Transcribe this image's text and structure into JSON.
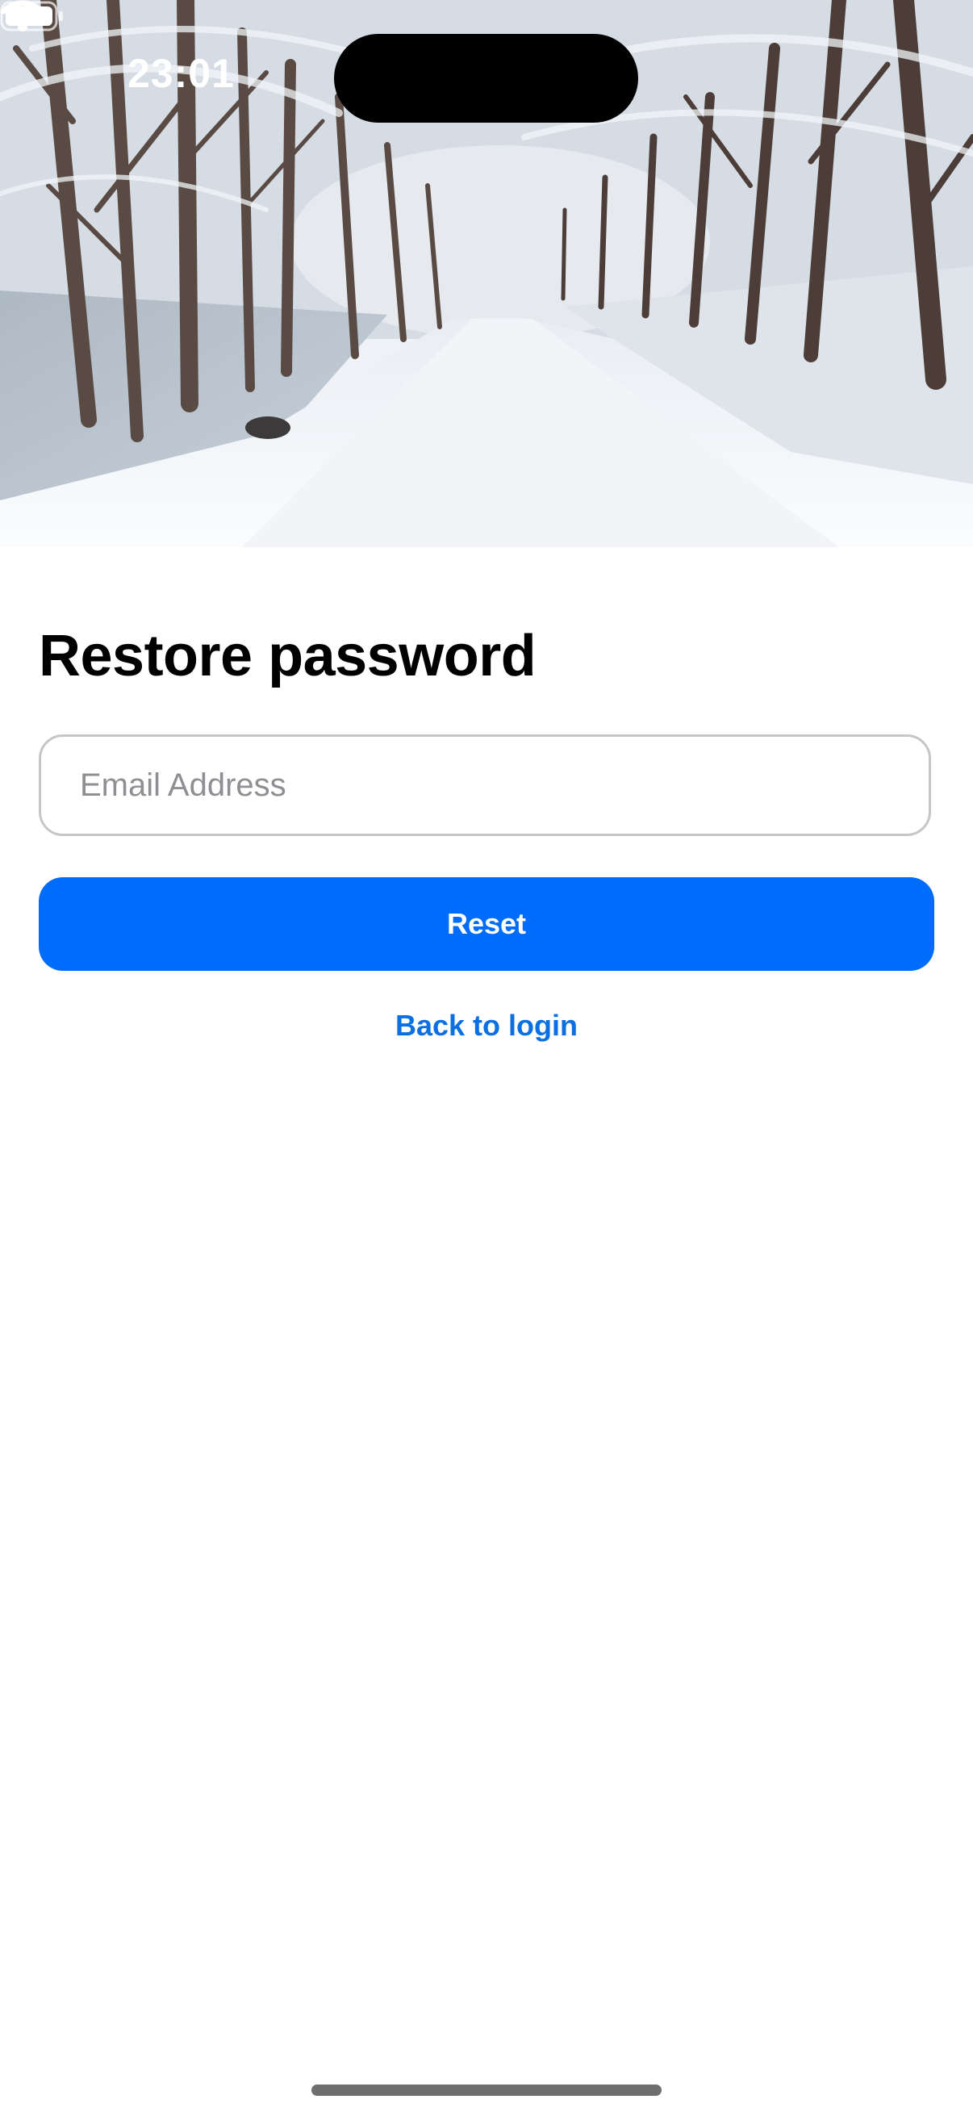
{
  "status_bar": {
    "time": "23:01",
    "wifi_icon": "wifi-icon",
    "battery_icon": "battery-icon"
  },
  "hero": {
    "image": "snowy-tree-lined-road-photo"
  },
  "screen": {
    "title": "Restore password",
    "email_placeholder": "Email Address",
    "email_value": "",
    "reset_label": "Reset",
    "back_label": "Back to login"
  },
  "colors": {
    "accent": "#006cfb",
    "link": "#0a6fe0",
    "field_border": "#c6c6c8",
    "placeholder": "#8e8e93"
  }
}
